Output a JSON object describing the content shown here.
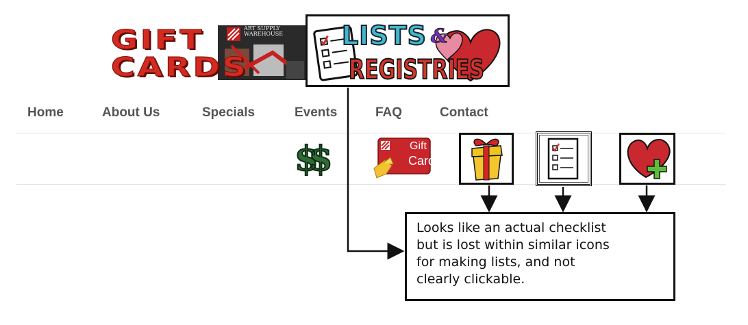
{
  "banners": {
    "gift_cards": {
      "line1": "GIFT",
      "line2": "CARDS",
      "store_name": "ART SUPPLY WAREHOUSE"
    },
    "lists_registries": {
      "word1": "LISTS",
      "amp": "&",
      "word2": "REGISTRIES"
    }
  },
  "nav": {
    "items": [
      {
        "label": "Home"
      },
      {
        "label": "About Us"
      },
      {
        "label": "Specials"
      },
      {
        "label": "Events"
      },
      {
        "label": "FAQ"
      },
      {
        "label": "Contact"
      }
    ]
  },
  "icons": {
    "money": {
      "text": "$$",
      "color": "#2e6b35"
    },
    "gift_card": {
      "line1": "Gift",
      "line2": "Card",
      "color": "#c9262c"
    },
    "present": {
      "name": "gift-box-icon"
    },
    "checklist": {
      "name": "checklist-icon"
    },
    "heart_plus": {
      "name": "heart-plus-icon"
    }
  },
  "annotation": {
    "lines": [
      "Looks like an actual checklist",
      "but is lost within similar icons",
      "for making lists, and not",
      "clearly clickable."
    ]
  },
  "colors": {
    "brand_red": "#d42a20",
    "accent_teal": "#43b8c8",
    "nav_text": "#555555"
  }
}
